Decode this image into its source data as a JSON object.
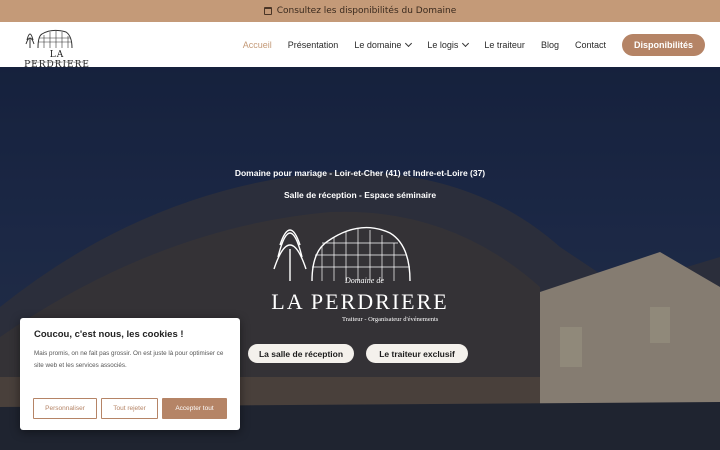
{
  "topbar": {
    "text": "Consultez les disponibilités du Domaine",
    "icon": "calendar-icon"
  },
  "logo": {
    "name": "LA PERDRIERE",
    "tagline": "Traiteur - Organisateur d'événements"
  },
  "nav": {
    "items": [
      {
        "label": "Accueil",
        "active": true
      },
      {
        "label": "Présentation"
      },
      {
        "label": "Le domaine",
        "has_dropdown": true
      },
      {
        "label": "Le logis",
        "has_dropdown": true
      },
      {
        "label": "Le traiteur"
      },
      {
        "label": "Blog"
      },
      {
        "label": "Contact"
      }
    ],
    "cta": "Disponibilités"
  },
  "hero": {
    "tagline1": "Domaine pour mariage - Loir-et-Cher (41) et Indre-et-Loire (37)",
    "tagline2": "Salle de réception - Espace séminaire",
    "logo_de": "Domaine de",
    "logo_title": "LA PERDRIERE",
    "logo_sub": "Traiteur - Organisateur d'événements",
    "buttons": [
      "La salle de réception",
      "Le traiteur exclusif"
    ]
  },
  "cookie": {
    "title": "Coucou, c'est nous, les cookies !",
    "body": "Mais promis, on ne fait pas grossir. On est juste là pour optimiser ce site web et les services associés.",
    "buttons": {
      "customize": "Personnaliser",
      "reject": "Tout rejeter",
      "accept": "Accepter tout"
    }
  },
  "colors": {
    "accent": "#b58466",
    "topbar": "#c49a78",
    "active_link": "#c49a78"
  }
}
